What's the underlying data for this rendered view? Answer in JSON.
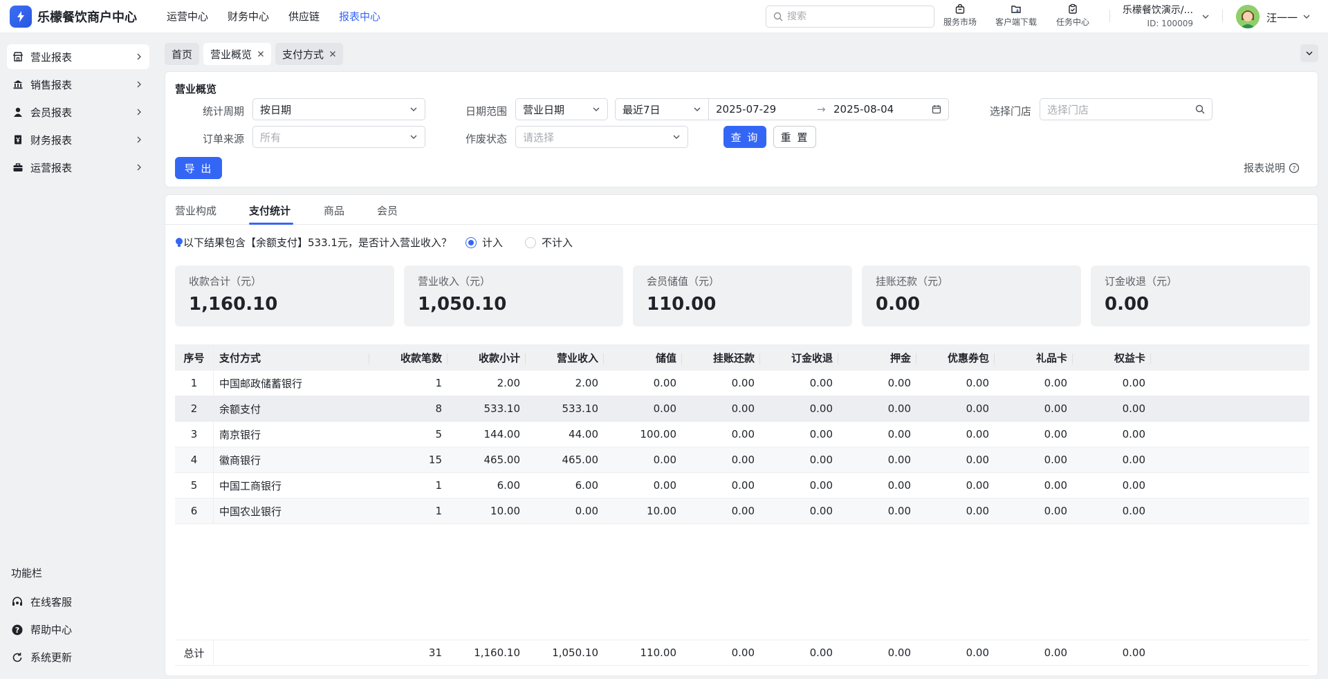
{
  "app": {
    "title": "乐檬餐饮商户中心"
  },
  "topnav": [
    {
      "label": "运营中心",
      "active": false
    },
    {
      "label": "财务中心",
      "active": false
    },
    {
      "label": "供应链",
      "active": false
    },
    {
      "label": "报表中心",
      "active": true
    }
  ],
  "search": {
    "placeholder": "搜索"
  },
  "tools": {
    "market": "服务市场",
    "download": "客户端下载",
    "tasks": "任务中心"
  },
  "account": {
    "name": "乐檬餐饮演示/...",
    "id": "ID: 100009"
  },
  "user": {
    "name": "汪一一"
  },
  "sidebar": {
    "items": [
      {
        "label": "营业报表",
        "icon": "store-icon"
      },
      {
        "label": "销售报表",
        "icon": "bank-icon"
      },
      {
        "label": "会员报表",
        "icon": "user-icon"
      },
      {
        "label": "财务报表",
        "icon": "ledger-icon"
      },
      {
        "label": "运营报表",
        "icon": "briefcase-icon"
      }
    ],
    "footer_title": "功能栏",
    "footer": [
      {
        "label": "在线客服",
        "icon": "headset-icon"
      },
      {
        "label": "帮助中心",
        "icon": "help-icon"
      },
      {
        "label": "系统更新",
        "icon": "refresh-icon"
      }
    ]
  },
  "tabs": [
    {
      "label": "首页",
      "closable": false
    },
    {
      "label": "营业概览",
      "closable": true,
      "active": true
    },
    {
      "label": "支付方式",
      "closable": true
    }
  ],
  "filters": {
    "title": "营业概览",
    "period_label": "统计周期",
    "period_value": "按日期",
    "range_label": "日期范围",
    "range_type": "营业日期",
    "range_preset": "最近7日",
    "date_start": "2025-07-29",
    "date_end": "2025-08-04",
    "store_label": "选择门店",
    "store_placeholder": "选择门店",
    "source_label": "订单来源",
    "source_placeholder": "所有",
    "void_label": "作废状态",
    "void_placeholder": "请选择",
    "query": "查 询",
    "reset": "重 置",
    "export": "导 出",
    "help": "报表说明"
  },
  "subtabs": [
    {
      "label": "营业构成"
    },
    {
      "label": "支付统计",
      "active": true
    },
    {
      "label": "商品"
    },
    {
      "label": "会员"
    }
  ],
  "notice": {
    "text": "以下结果包含【余额支付】533.1元，是否计入营业收入？",
    "include": "计入",
    "exclude": "不计入",
    "selected": "计入"
  },
  "cards": [
    {
      "label": "收款合计（元）",
      "value": "1,160.10"
    },
    {
      "label": "营业收入（元）",
      "value": "1,050.10"
    },
    {
      "label": "会员储值（元）",
      "value": "110.00"
    },
    {
      "label": "挂账还款（元）",
      "value": "0.00"
    },
    {
      "label": "订金收退（元）",
      "value": "0.00"
    }
  ],
  "table": {
    "columns": [
      "序号",
      "支付方式",
      "收款笔数",
      "收款小计",
      "营业收入",
      "储值",
      "挂账还款",
      "订金收退",
      "押金",
      "优惠券包",
      "礼品卡",
      "权益卡"
    ],
    "rows": [
      [
        "1",
        "中国邮政储蓄银行",
        "1",
        "2.00",
        "2.00",
        "0.00",
        "0.00",
        "0.00",
        "0.00",
        "0.00",
        "0.00",
        "0.00"
      ],
      [
        "2",
        "余额支付",
        "8",
        "533.10",
        "533.10",
        "0.00",
        "0.00",
        "0.00",
        "0.00",
        "0.00",
        "0.00",
        "0.00"
      ],
      [
        "3",
        "南京银行",
        "5",
        "144.00",
        "44.00",
        "100.00",
        "0.00",
        "0.00",
        "0.00",
        "0.00",
        "0.00",
        "0.00"
      ],
      [
        "4",
        "徽商银行",
        "15",
        "465.00",
        "465.00",
        "0.00",
        "0.00",
        "0.00",
        "0.00",
        "0.00",
        "0.00",
        "0.00"
      ],
      [
        "5",
        "中国工商银行",
        "1",
        "6.00",
        "6.00",
        "0.00",
        "0.00",
        "0.00",
        "0.00",
        "0.00",
        "0.00",
        "0.00"
      ],
      [
        "6",
        "中国农业银行",
        "1",
        "10.00",
        "0.00",
        "10.00",
        "0.00",
        "0.00",
        "0.00",
        "0.00",
        "0.00",
        "0.00"
      ]
    ],
    "footer": [
      "总计",
      "",
      "31",
      "1,160.10",
      "1,050.10",
      "110.00",
      "0.00",
      "0.00",
      "0.00",
      "0.00",
      "0.00",
      "0.00"
    ]
  },
  "colors": {
    "accent": "#3466f6",
    "background": "#f0f1f3"
  }
}
